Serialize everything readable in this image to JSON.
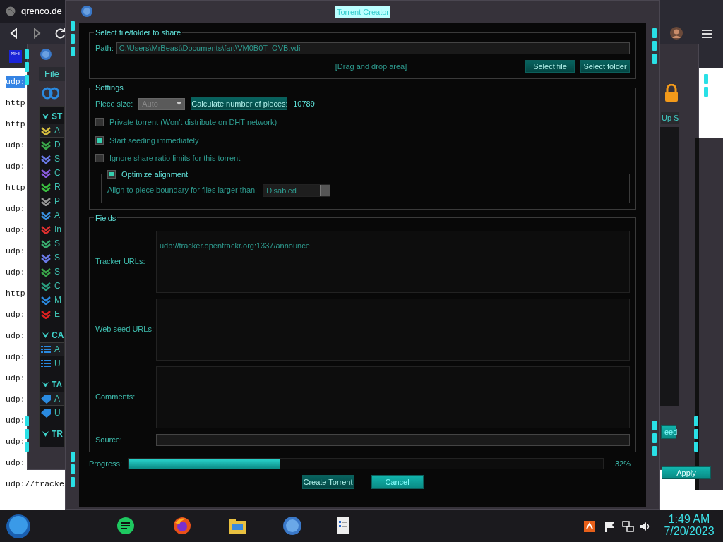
{
  "browser": {
    "tab_title": "qrenco.de",
    "extension_label": "MFT",
    "page_lines": [
      {
        "text": "udp:",
        "selected": true
      },
      {
        "text": "http",
        "selected": false
      },
      {
        "text": "http",
        "selected": false
      },
      {
        "text": "udp:",
        "selected": false
      },
      {
        "text": "udp:",
        "selected": false
      },
      {
        "text": "http",
        "selected": false
      },
      {
        "text": "udp:",
        "selected": false
      },
      {
        "text": "udp:",
        "selected": false
      },
      {
        "text": "udp:",
        "selected": false
      },
      {
        "text": "udp:",
        "selected": false
      },
      {
        "text": "http",
        "selected": false
      },
      {
        "text": "udp:",
        "selected": false
      },
      {
        "text": "udp:",
        "selected": false
      },
      {
        "text": "udp:",
        "selected": false
      },
      {
        "text": "udp:",
        "selected": false
      },
      {
        "text": "udp:",
        "selected": false
      },
      {
        "text": "udp:",
        "selected": false
      },
      {
        "text": "udp:",
        "selected": false
      },
      {
        "text": "udp:",
        "selected": false
      },
      {
        "text": "udp://tracke",
        "selected": false
      }
    ]
  },
  "background_window": {
    "menu": [
      "File"
    ],
    "sidebar": [
      {
        "heading": "ST",
        "items": [
          {
            "label": "A",
            "selected": true
          },
          {
            "label": "D",
            "selected": false
          },
          {
            "label": "S",
            "selected": false
          },
          {
            "label": "C",
            "selected": false
          },
          {
            "label": "R",
            "selected": false
          },
          {
            "label": "P",
            "selected": false
          },
          {
            "label": "A",
            "selected": false
          },
          {
            "label": "In",
            "selected": false
          },
          {
            "label": "S",
            "selected": false
          },
          {
            "label": "S",
            "selected": false
          },
          {
            "label": "S",
            "selected": false
          },
          {
            "label": "C",
            "selected": false
          },
          {
            "label": "M",
            "selected": false
          },
          {
            "label": "E",
            "selected": false
          }
        ]
      },
      {
        "heading": "CA",
        "items": [
          {
            "label": "A",
            "selected": true
          },
          {
            "label": "U",
            "selected": false
          }
        ]
      },
      {
        "heading": "TA",
        "items": [
          {
            "label": "A",
            "selected": true
          },
          {
            "label": "U",
            "selected": false
          }
        ]
      },
      {
        "heading": "TR"
      }
    ],
    "column_header": "Up S",
    "button": "eed"
  },
  "options_window": {
    "button": "Apply"
  },
  "dialog": {
    "title": "Torrent Creator",
    "source_group": {
      "title": "Select file/folder to share",
      "path_label": "Path:",
      "path": "C:\\Users\\MrBeast\\Documents\\fart\\VM0B0T_OVB.vdi",
      "drop_area": "[Drag and drop area]",
      "buttons": [
        "Select file",
        "Select folder"
      ]
    },
    "settings_group": {
      "title": "Settings",
      "piece_size_label": "Piece size:",
      "piece_size": "Auto",
      "calculate_button": "Calculate number of pieces:",
      "piece_count": "10789",
      "options": [
        {
          "label": "Private torrent (Won't distribute on DHT network)",
          "checked": false
        },
        {
          "label": "Start seeding immediately",
          "checked": true
        },
        {
          "label": "Ignore share ratio limits for this torrent",
          "checked": false
        }
      ],
      "alignment": {
        "label": "Optimize alignment",
        "checked": true,
        "boundary_label": "Align to piece boundary for files larger than:",
        "boundary_value": "Disabled"
      }
    },
    "fields_group": {
      "title": "Fields",
      "tracker_label": "Tracker URLs:",
      "tracker_urls": "udp://tracker.opentrackr.org:1337/announce",
      "web_seed_label": "Web seed URLs:",
      "comments_label": "Comments:",
      "source_label": "Source:"
    },
    "progress": {
      "label": "Progress:",
      "level": 0.32,
      "reading": "32%"
    },
    "buttons": [
      {
        "label": "Create Torrent",
        "disabled": true
      },
      {
        "label": "Cancel",
        "disabled": false
      }
    ]
  },
  "taskbar": {
    "time": "1:49 AM",
    "date": "7/20/2023"
  }
}
